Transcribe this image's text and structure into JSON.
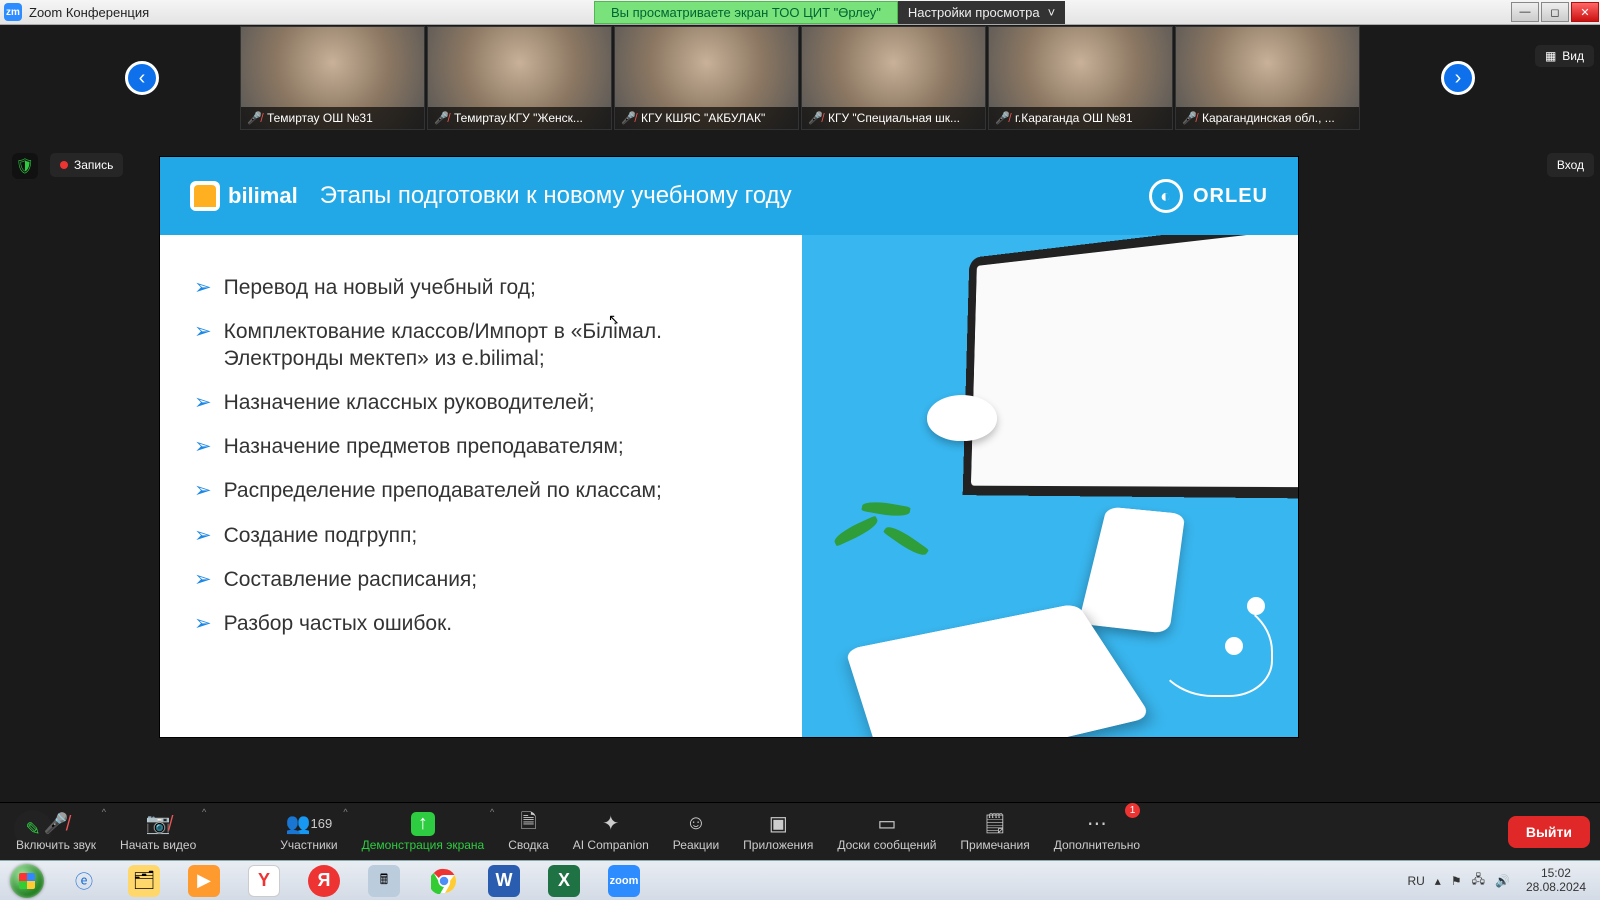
{
  "titlebar": {
    "app_icon_text": "zm",
    "title": "Zoom Конференция",
    "banner": "Вы просматриваете экран ТОО  ЦИТ \"Өрлеу\"",
    "view_options": "Настройки просмотра"
  },
  "pills": {
    "recording": "Запись",
    "view": "Вид",
    "login": "Вход"
  },
  "gallery": [
    {
      "name": "Темиртау ОШ №31"
    },
    {
      "name": "Темиртау.КГУ \"Женск..."
    },
    {
      "name": "КГУ КШЯС \"АКБУЛАК\""
    },
    {
      "name": "КГУ \"Специальная шк..."
    },
    {
      "name": "г.Караганда ОШ №81"
    },
    {
      "name": "Карагандинская обл., ..."
    }
  ],
  "slide": {
    "logo_text": "bilimal",
    "title": "Этапы подготовки к новому учебному году",
    "brand": "ORLEU",
    "bullets": [
      "Перевод на новый учебный год;",
      "Комплектование классов/Импорт в «Білімал. Электронды мектеп» из e.bilimal;",
      "Назначение классных руководителей;",
      "Назначение предметов преподавателям;",
      "Распределение преподавателей по классам;",
      "Создание подгрупп;",
      "Составление расписания;",
      "Разбор частых ошибок."
    ]
  },
  "toolbar": {
    "audio": "Включить звук",
    "video": "Начать видео",
    "participants": "Участники",
    "participants_count": "169",
    "share": "Демонстрация экрана",
    "summary": "Сводка",
    "ai": "AI Companion",
    "reactions": "Реакции",
    "apps": "Приложения",
    "boards": "Доски сообщений",
    "notes": "Примечания",
    "more": "Дополнительно",
    "more_badge": "1",
    "leave": "Выйти"
  },
  "systray": {
    "lang": "RU",
    "time": "15:02",
    "date": "28.08.2024"
  }
}
